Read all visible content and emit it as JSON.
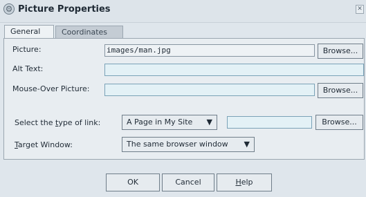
{
  "window": {
    "title": "Picture Properties",
    "icon": "gear-icon",
    "close_icon": "close-icon"
  },
  "tabs": [
    {
      "label": "General"
    },
    {
      "label": "Coordinates"
    }
  ],
  "form": {
    "picture": {
      "label": "Picture:",
      "value": "images/man.jpg",
      "browse": "Browse..."
    },
    "alt_text": {
      "label": "Alt Text:",
      "value": ""
    },
    "mouse_over": {
      "label": "Mouse-Over Picture:",
      "value": "",
      "browse": "Browse..."
    },
    "link_type": {
      "label_pre": "Select the ",
      "label_underline": "t",
      "label_post": "ype of link:",
      "selected": "A Page in My Site",
      "value": "",
      "browse": "Browse..."
    },
    "target_window": {
      "label_underline": "T",
      "label_post": "arget Window:",
      "selected": "The same browser window"
    }
  },
  "footer": {
    "ok": "OK",
    "cancel": "Cancel",
    "help_underline": "H",
    "help_post": "elp"
  },
  "colors": {
    "panel_bg": "#e8edf1",
    "field_blank": "#e3f1f6",
    "accent_border": "#7aa2b7"
  }
}
